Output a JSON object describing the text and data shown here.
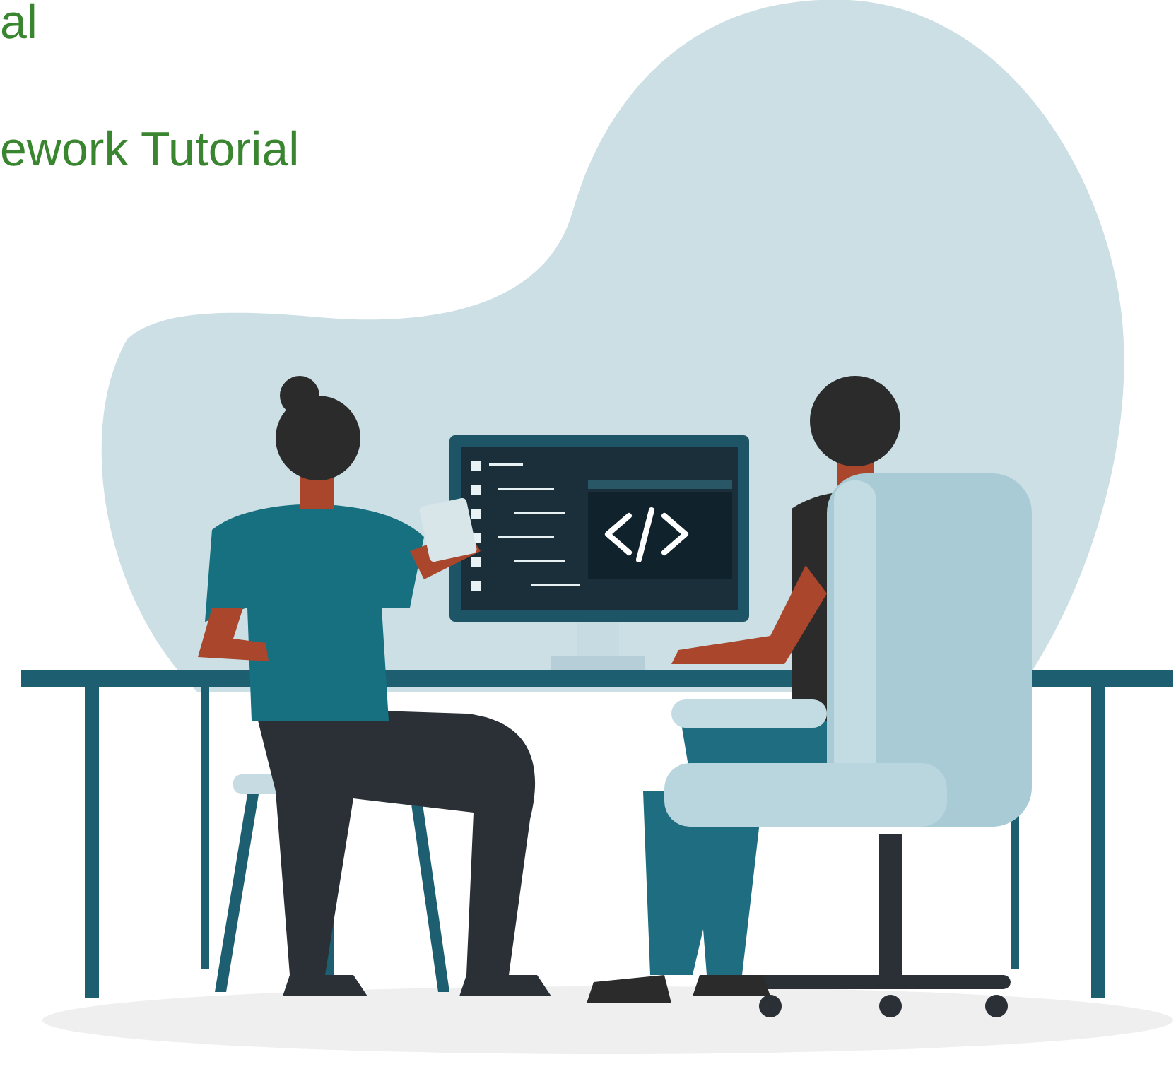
{
  "headings": [
    "al",
    "ework Tutorial"
  ]
}
